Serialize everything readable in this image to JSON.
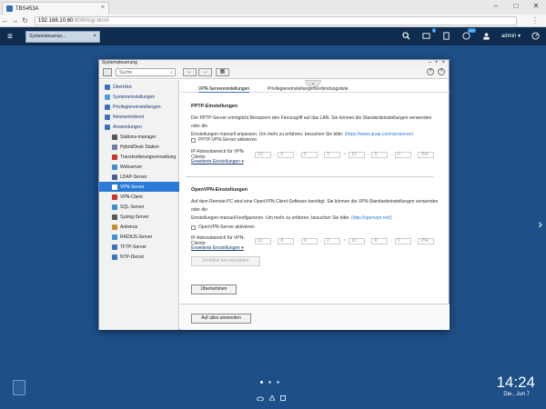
{
  "browser": {
    "tab_title": "TBS453A",
    "tab_close": "×",
    "win_controls": [
      "–",
      "□",
      "✕"
    ],
    "back": "←",
    "forward": "→",
    "reload": "↻",
    "url_host": "192.168.10.60",
    "url_rest": ":8080/cgi-bin/#",
    "menu": "⋮"
  },
  "qts": {
    "menu_icon": "≡",
    "app_tab": "Systemsteuerun...",
    "app_tab_close": "×",
    "badge_1": "1",
    "badge_2": "10+",
    "user": "admin ▾"
  },
  "window": {
    "title": "Systemsteuerung",
    "btn_min": "–",
    "btn_max": "+",
    "btn_close": "×",
    "search_placeholder": "Suche",
    "back": "←",
    "forward": "→",
    "grid": "▦",
    "help_a": "?",
    "help_b": "?"
  },
  "nav": {
    "items": [
      {
        "label": "Überblick",
        "icon": "home-icon",
        "color": "#3a74c0"
      },
      {
        "label": "Systemeinstellungen",
        "icon": "gear-icon",
        "color": "#4aa0d8"
      },
      {
        "label": "Privilegieneinstellungen",
        "icon": "user-icon",
        "color": "#3a74c0"
      },
      {
        "label": "Netzwerkdienst",
        "icon": "globe-icon",
        "color": "#3a74c0"
      },
      {
        "label": "Anwendungen",
        "icon": "apps-icon",
        "color": "#3a74c0"
      }
    ],
    "sub_items": [
      {
        "label": "Stations-manager",
        "color": "#555"
      },
      {
        "label": "HybridDesk Station",
        "color": "#6b7fa8"
      },
      {
        "label": "Transkodierungsverwaltung",
        "color": "#c9352e"
      },
      {
        "label": "Webserver",
        "color": "#3f8fd6"
      },
      {
        "label": "LDAP-Server",
        "color": "#4c5f8a"
      },
      {
        "label": "VPN-Server",
        "color": "#ffffff"
      },
      {
        "label": "VPN-Client",
        "color": "#c9352e"
      },
      {
        "label": "SQL-Server",
        "color": "#3f8fd6"
      },
      {
        "label": "Syslog-Server",
        "color": "#555"
      },
      {
        "label": "Antivirus",
        "color": "#c98a2e"
      },
      {
        "label": "RADIUS-Server",
        "color": "#3f8fd6"
      },
      {
        "label": "TFTP-Server",
        "color": "#3a74c0"
      },
      {
        "label": "NTP-Dienst",
        "color": "#3a74c0"
      }
    ]
  },
  "tabs": [
    "VPN-Servereinstellungen",
    "Privilegieneinstellungen",
    "Verbindungsliste"
  ],
  "tab_arrow": "⌄",
  "pptp": {
    "title": "PPTP-Einstellungen",
    "desc_1": "Der PPTP-Server ermöglicht Benutzern den Fernzugriff auf das LAN. Sie können die Standardeinstellungen verwenden oder die",
    "desc_2a": "Einstellungen manuell anpassen. Um mehr zu erfahren, besuchen Sie bitte:",
    "desc_2link": "(https://www.qnap.com/vpnserver)",
    "enable": "PPTP-VPN-Server aktivieren",
    "ip_label": "IP-Adressbereich für VPN-Clients:",
    "ip_start": [
      "10",
      "0",
      "0",
      "2"
    ],
    "ip_end": [
      "10",
      "0",
      "0",
      "254"
    ],
    "advanced": "Erweiterte Einstellungen ▾"
  },
  "openvpn": {
    "title": "OpenVPN-Einstellungen",
    "desc_1": "Auf dem Remote-PC wird eine OpenVPN-Client-Software benötigt. Sie können die VPN-Standardeinstellungen verwenden oder die",
    "desc_2a": "Einstellungen manuell konfigurieren. Um mehr zu erfahren, besuchen Sie bitte:",
    "desc_2link": "(http://openvpn.net/)",
    "enable": "OpenVPN-Server aktivieren",
    "ip_label": "IP-Adressbereich für VPN-Clients:",
    "ip_start": [
      "10",
      "8",
      "0",
      "2"
    ],
    "ip_end": [
      "10",
      "8",
      "0",
      "254"
    ],
    "advanced": "Erweiterte Einstellungen ▾",
    "cert_button": "Zertifikat herunterladen"
  },
  "apply_button": "Übernehmen",
  "apply_all_button": "Auf alles anwenden",
  "desktop": {
    "time": "14:24",
    "date": "Die., Jun 7",
    "side_arrow": "›"
  }
}
